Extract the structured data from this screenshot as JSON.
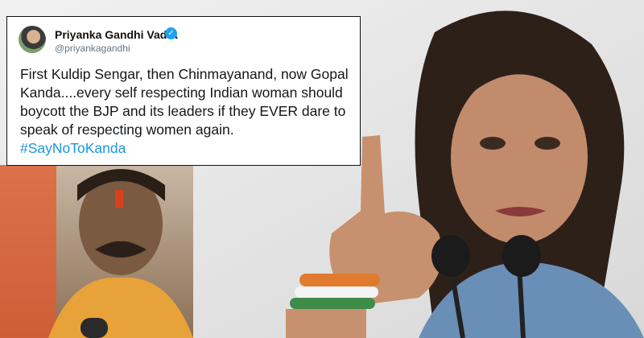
{
  "tweet": {
    "display_name": "Priyanka Gandhi Vadra",
    "handle": "@priyankagandhi",
    "text": "First Kuldip Sengar, then Chinmayanand, now Gopal Kanda....every self respecting Indian woman should boycott the BJP and its leaders if they EVER dare to speak of respecting women again.",
    "hashtag": "#SayNoToKanda",
    "verified_icon": "verified-badge-icon"
  },
  "colors": {
    "link": "#1b95e0",
    "verified": "#1da1f2",
    "frame_border": "#111111"
  }
}
